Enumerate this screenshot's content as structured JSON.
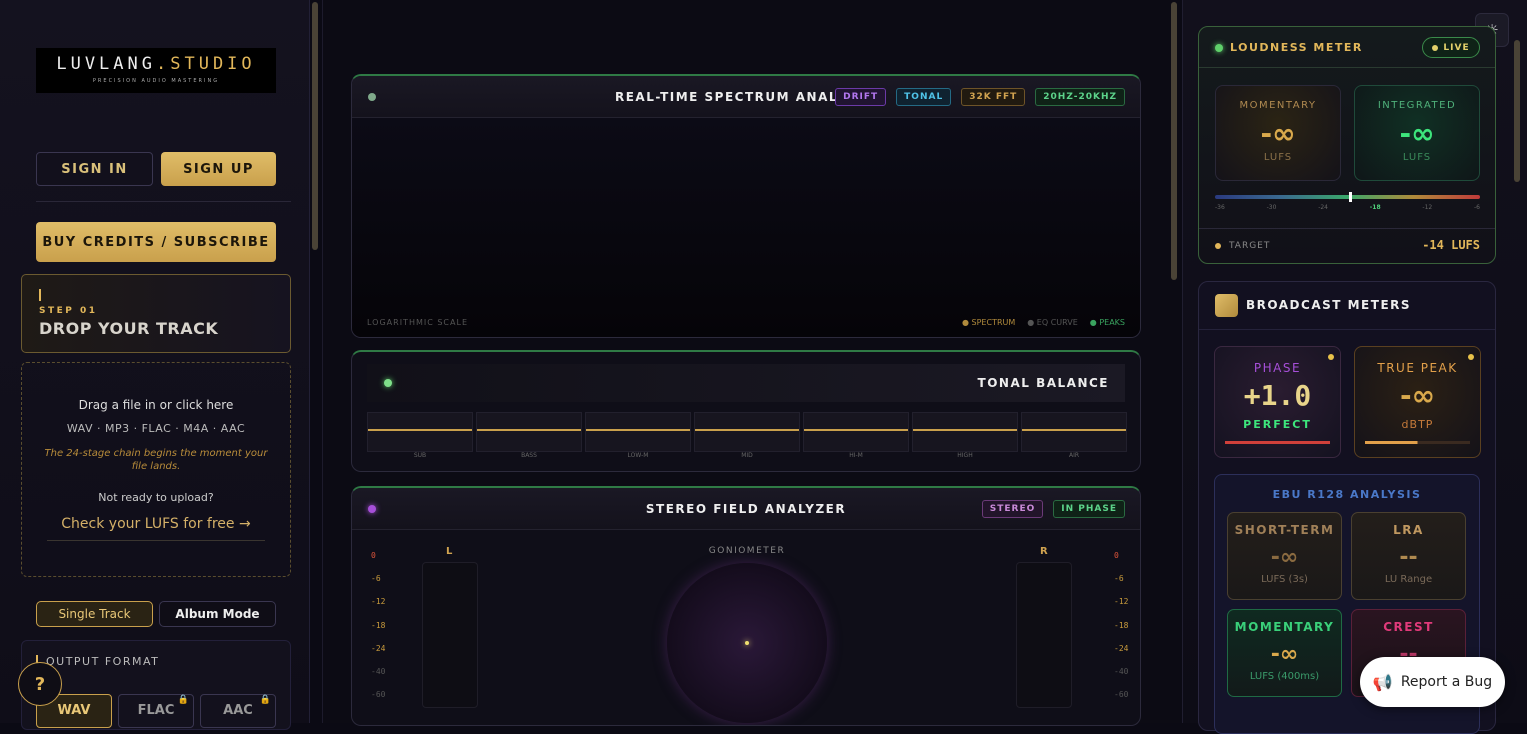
{
  "brand": {
    "name_a": "LUVLANG",
    "name_b": ".STUDIO",
    "tagline": "PRECISION AUDIO MASTERING"
  },
  "auth": {
    "sign_in": "SIGN IN",
    "sign_up": "SIGN UP",
    "buy": "BUY CREDITS / SUBSCRIBE"
  },
  "step": {
    "number": "STEP 01",
    "title": "DROP YOUR TRACK"
  },
  "drop": {
    "prompt": "Drag a file in or click here",
    "formats": "WAV · MP3 · FLAC · M4A · AAC",
    "note": "The 24-stage chain begins the moment your file lands.",
    "not_ready": "Not ready to upload?",
    "check_link": "Check your LUFS for free →"
  },
  "modes": {
    "single": "Single Track",
    "album": "Album Mode"
  },
  "output": {
    "label": "OUTPUT FORMAT",
    "formats": [
      "WAV",
      "FLAC",
      "AAC"
    ]
  },
  "help_label": "?",
  "spectrum": {
    "title": "REAL-TIME SPECTRUM ANALYZER",
    "tags": [
      "DRIFT",
      "TONAL",
      "32K FFT",
      "20HZ-20KHZ"
    ],
    "scale": "LOGARITHMIC SCALE",
    "legend": [
      "● SPECTRUM",
      "● EQ CURVE",
      "● PEAKS"
    ]
  },
  "tonal": {
    "title": "TONAL BALANCE",
    "bands": [
      "SUB",
      "BASS",
      "LOW-M",
      "MID",
      "HI-M",
      "HIGH",
      "AIR"
    ]
  },
  "stereo": {
    "title": "STEREO FIELD ANALYZER",
    "tags": [
      "STEREO",
      "IN PHASE"
    ],
    "left": "L",
    "right": "R",
    "gonio": "GONIOMETER",
    "scale": [
      "0",
      "-6",
      "-12",
      "-18",
      "-24",
      "-40",
      "-60"
    ]
  },
  "loudness": {
    "title": "LOUDNESS METER",
    "live": "LIVE",
    "momentary_label": "MOMENTARY",
    "momentary_value": "-∞",
    "momentary_unit": "LUFS",
    "integrated_label": "INTEGRATED",
    "integrated_value": "-∞",
    "integrated_unit": "LUFS",
    "scale": [
      "-36",
      "-30",
      "-24",
      "-18",
      "-12",
      "-6"
    ],
    "target_label": "TARGET",
    "target_value": "-14 LUFS"
  },
  "broadcast": {
    "title": "BROADCAST METERS",
    "phase_label": "PHASE",
    "phase_value": "+1.0",
    "phase_status": "PERFECT",
    "tp_label": "TRUE PEAK",
    "tp_value": "-∞",
    "tp_unit": "dBTP"
  },
  "ebu": {
    "title": "EBU R128 ANALYSIS",
    "short_label": "SHORT-TERM",
    "short_value": "-∞",
    "short_unit": "LUFS (3s)",
    "lra_label": "LRA",
    "lra_value": "--",
    "lra_unit": "LU Range",
    "mom_label": "MOMENTARY",
    "mom_value": "-∞",
    "mom_unit": "LUFS (400ms)",
    "crest_label": "CREST",
    "crest_value": "--"
  },
  "bug": {
    "label": "Report a Bug"
  }
}
